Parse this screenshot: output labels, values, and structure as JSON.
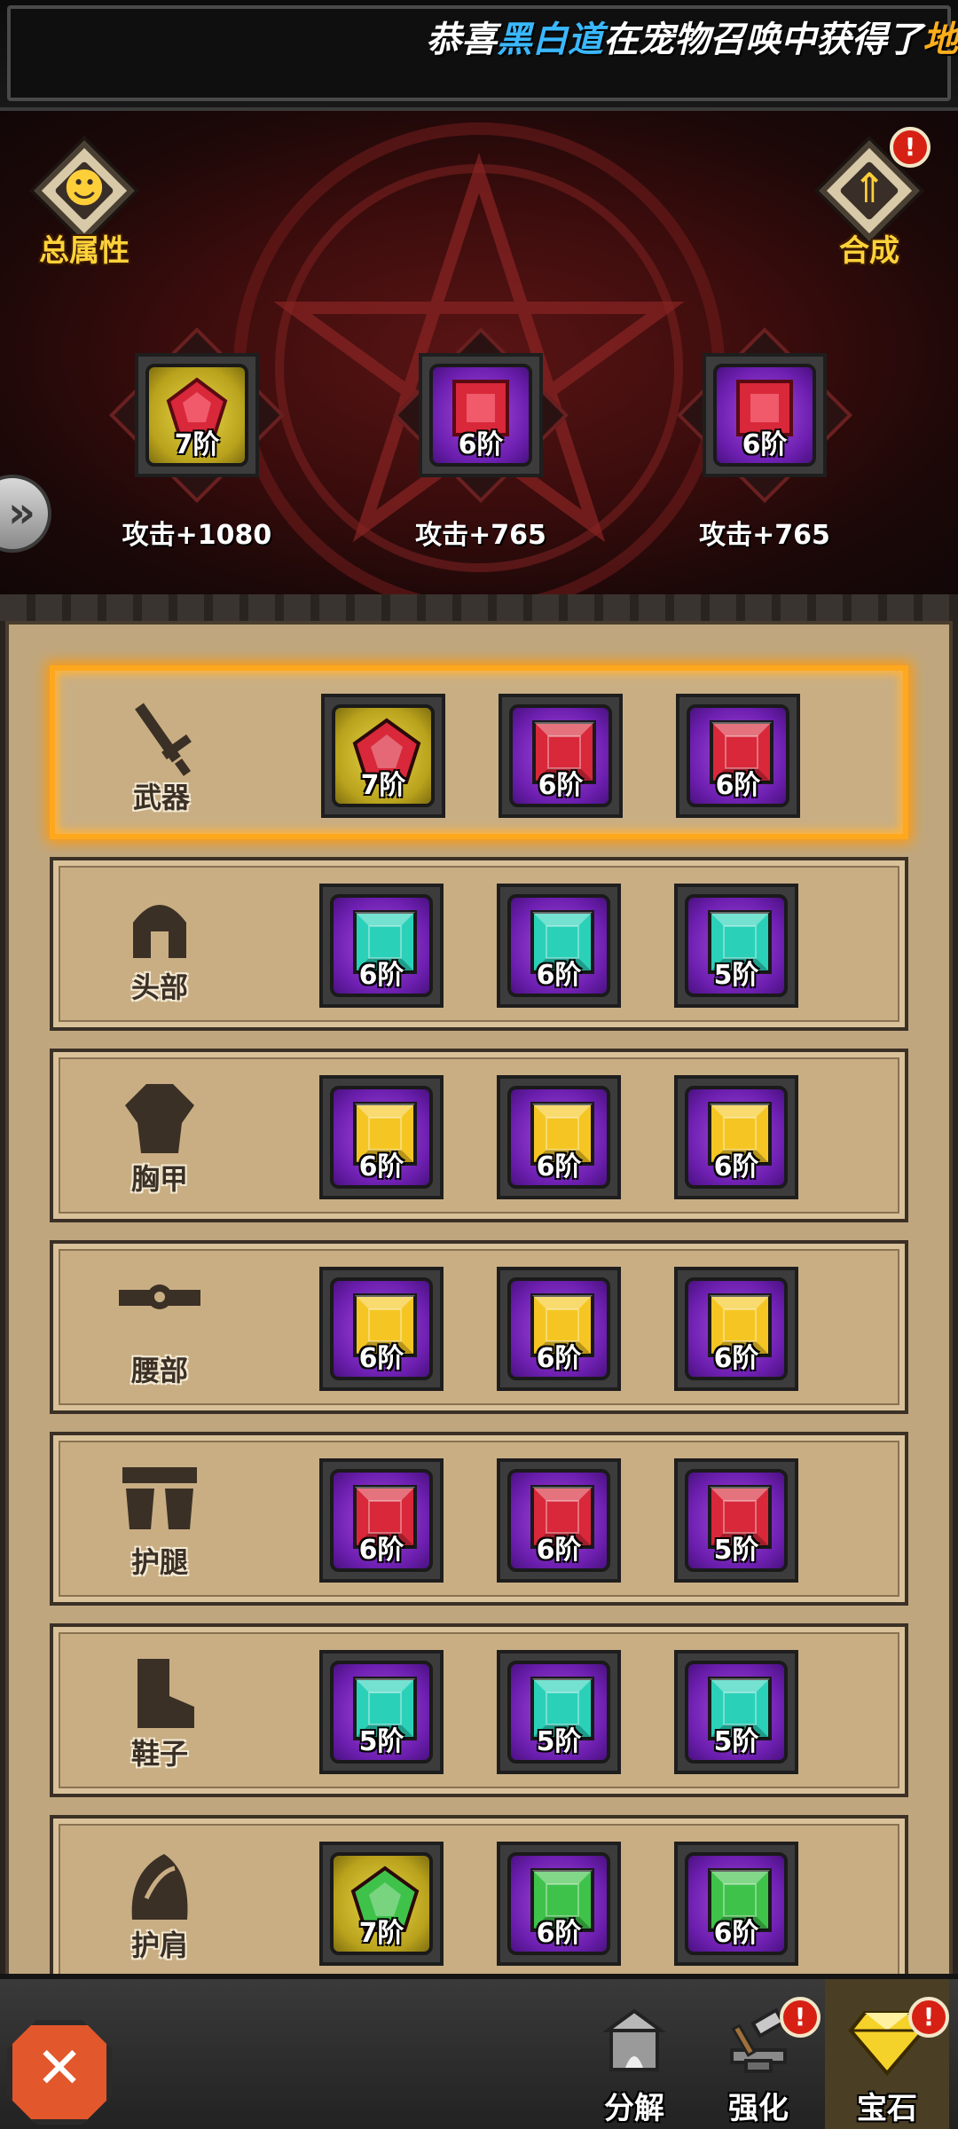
{
  "banner": {
    "prefix": "恭喜",
    "player": "黑白道",
    "middle": "在宠物召唤中获得了",
    "reward": "地狱"
  },
  "altar": {
    "total_attrs_label": "总属性",
    "synthesize_label": "合成",
    "alert_mark": "!",
    "side_arrow": "»",
    "slots": [
      {
        "tier": "7阶",
        "frame": "gold",
        "gem": "red-pentagon",
        "attr": "攻击+1080"
      },
      {
        "tier": "6阶",
        "frame": "purple",
        "gem": "red-square",
        "attr": "攻击+765"
      },
      {
        "tier": "6阶",
        "frame": "purple",
        "gem": "red-square",
        "attr": "攻击+765"
      }
    ]
  },
  "equipment": [
    {
      "part": "武器",
      "icon": "sword-icon",
      "selected": true,
      "gems": [
        {
          "tier": "7阶",
          "frame": "gold",
          "color": "#d8283a"
        },
        {
          "tier": "6阶",
          "frame": "purple",
          "color": "#d8283a"
        },
        {
          "tier": "6阶",
          "frame": "purple",
          "color": "#d8283a"
        }
      ]
    },
    {
      "part": "头部",
      "icon": "helmet-icon",
      "selected": false,
      "gems": [
        {
          "tier": "6阶",
          "frame": "purple",
          "color": "#2ad1b8"
        },
        {
          "tier": "6阶",
          "frame": "purple",
          "color": "#2ad1b8"
        },
        {
          "tier": "5阶",
          "frame": "purple",
          "color": "#2ad1b8"
        }
      ]
    },
    {
      "part": "胸甲",
      "icon": "chest-armor-icon",
      "selected": false,
      "gems": [
        {
          "tier": "6阶",
          "frame": "purple",
          "color": "#f5c623"
        },
        {
          "tier": "6阶",
          "frame": "purple",
          "color": "#f5c623"
        },
        {
          "tier": "6阶",
          "frame": "purple",
          "color": "#f5c623"
        }
      ]
    },
    {
      "part": "腰部",
      "icon": "belt-icon",
      "selected": false,
      "gems": [
        {
          "tier": "6阶",
          "frame": "purple",
          "color": "#f5c623"
        },
        {
          "tier": "6阶",
          "frame": "purple",
          "color": "#f5c623"
        },
        {
          "tier": "6阶",
          "frame": "purple",
          "color": "#f5c623"
        }
      ]
    },
    {
      "part": "护腿",
      "icon": "leg-guard-icon",
      "selected": false,
      "gems": [
        {
          "tier": "6阶",
          "frame": "purple",
          "color": "#d8283a"
        },
        {
          "tier": "6阶",
          "frame": "purple",
          "color": "#d8283a"
        },
        {
          "tier": "5阶",
          "frame": "purple",
          "color": "#d8283a"
        }
      ]
    },
    {
      "part": "鞋子",
      "icon": "boots-icon",
      "selected": false,
      "gems": [
        {
          "tier": "5阶",
          "frame": "purple",
          "color": "#2ad1b8"
        },
        {
          "tier": "5阶",
          "frame": "purple",
          "color": "#2ad1b8"
        },
        {
          "tier": "5阶",
          "frame": "purple",
          "color": "#2ad1b8"
        }
      ]
    },
    {
      "part": "护肩",
      "icon": "shoulder-guard-icon",
      "selected": false,
      "gems": [
        {
          "tier": "7阶",
          "frame": "gold",
          "color": "#3fc24a"
        },
        {
          "tier": "6阶",
          "frame": "purple",
          "color": "#3fc24a"
        },
        {
          "tier": "6阶",
          "frame": "purple",
          "color": "#3fc24a"
        }
      ]
    }
  ],
  "bottom_nav": {
    "close_mark": "✕",
    "decompose_label": "分解",
    "enhance_label": "强化",
    "gem_label": "宝石",
    "alert_mark": "!"
  },
  "colors": {
    "accent_gold": "#ffd23a",
    "selected_glow": "#ffa81e",
    "panel_tan": "#c9ae84"
  }
}
